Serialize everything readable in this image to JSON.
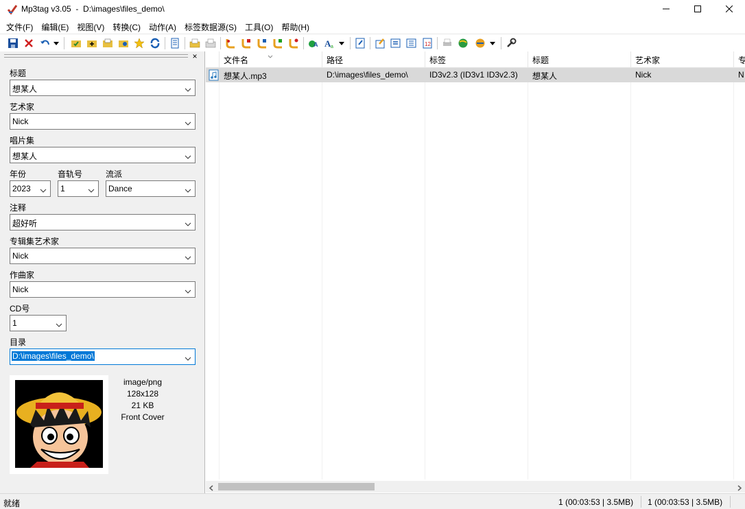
{
  "window": {
    "title": "Mp3tag v3.05  -  D:\\images\\files_demo\\",
    "minimize_icon": "minimize-icon",
    "maximize_icon": "maximize-icon",
    "close_icon": "close-icon"
  },
  "menu": [
    "文件(F)",
    "编辑(E)",
    "视图(V)",
    "转换(C)",
    "动作(A)",
    "标签数据源(S)",
    "工具(O)",
    "帮助(H)"
  ],
  "toolbar": {
    "icons": [
      "save-icon",
      "remove-tag-icon",
      "undo-icon",
      "dropdown-icon",
      "change-directory-icon",
      "add-directory-icon",
      "open-folder-icon",
      "favorites-icon",
      "refresh-icon",
      "extended-tags-icon",
      "convert-tag-filename-icon",
      "action-icon",
      "tag-sources-icon",
      "text-format-icon",
      "export-icon",
      "settings-icon"
    ],
    "accent": "#1a5fb4",
    "save_annotation_color": "#e03030"
  },
  "tag_panel": {
    "title": {
      "label": "标题",
      "value": "想某人"
    },
    "artist": {
      "label": "艺术家",
      "value": "Nick"
    },
    "album": {
      "label": "唱片集",
      "value": "想某人"
    },
    "year": {
      "label": "年份",
      "value": "2023"
    },
    "track": {
      "label": "音轨号",
      "value": "1"
    },
    "genre": {
      "label": "流派",
      "value": "Dance"
    },
    "comment": {
      "label": "注释",
      "value": "超好听"
    },
    "album_artist": {
      "label": "专辑集艺术家",
      "value": "Nick"
    },
    "composer": {
      "label": "作曲家",
      "value": "Nick"
    },
    "disc": {
      "label": "CD号",
      "value": "1"
    },
    "directory": {
      "label": "目录",
      "value": "D:\\images\\files_demo\\"
    },
    "cover": {
      "mime": "image/png",
      "dimensions": "128x128",
      "size": "21 KB",
      "type": "Front Cover"
    }
  },
  "file_list": {
    "columns": [
      "文件名",
      "路径",
      "标签",
      "标题",
      "艺术家",
      "专"
    ],
    "rows": [
      [
        "想某人.mp3",
        "D:\\images\\files_demo\\",
        "ID3v2.3 (ID3v1 ID3v2.3)",
        "想某人",
        "Nick",
        "N"
      ]
    ],
    "row_selected_color": "#d9d9d9"
  },
  "status": {
    "text": "就绪",
    "selected": "1 (00:03:53 | 3.5MB)",
    "total": "1 (00:03:53 | 3.5MB)"
  }
}
